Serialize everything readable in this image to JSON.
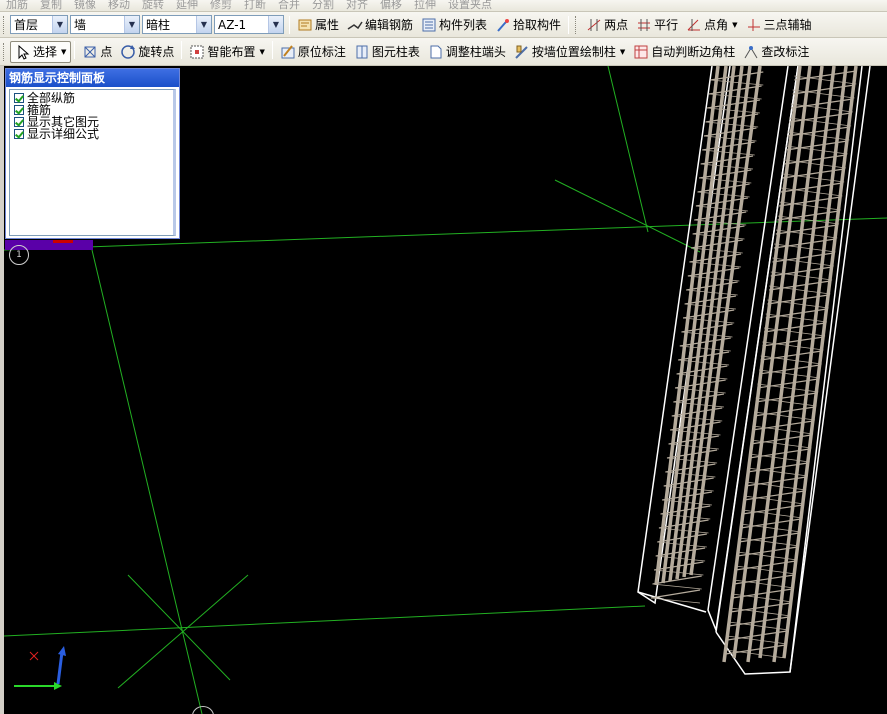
{
  "ghost_toolbar": [
    "加筋",
    "复制",
    "镜像",
    "移动",
    "旋转",
    "延伸",
    "修剪",
    "打断",
    "合并",
    "分割",
    "对齐",
    "偏移",
    "拉伸",
    "设置夹点"
  ],
  "toolbar1": {
    "floor": "首层",
    "component_type": "墙",
    "sub_type": "暗柱",
    "component_name": "AZ-1",
    "buttons": [
      {
        "name": "properties",
        "label": "属性",
        "icon": "properties-icon"
      },
      {
        "name": "edit-rebar",
        "label": "编辑钢筋",
        "icon": "edit-rebar-icon"
      },
      {
        "name": "component-list",
        "label": "构件列表",
        "icon": "list-icon"
      },
      {
        "name": "pick-component",
        "label": "拾取构件",
        "icon": "pick-icon"
      }
    ],
    "snap_buttons": [
      {
        "name": "two-points",
        "label": "两点",
        "icon": "two-points-icon"
      },
      {
        "name": "parallel",
        "label": "平行",
        "icon": "parallel-icon"
      },
      {
        "name": "point-angle",
        "label": "点角",
        "icon": "point-angle-icon"
      },
      {
        "name": "three-point-axis",
        "label": "三点辅轴",
        "icon": "three-point-icon"
      }
    ]
  },
  "toolbar2": {
    "buttons": [
      {
        "name": "select",
        "label": "选择",
        "icon": "cursor-icon"
      },
      {
        "name": "point",
        "label": "点",
        "icon": "point-icon"
      },
      {
        "name": "rotate-point",
        "label": "旋转点",
        "icon": "rotate-icon"
      },
      {
        "name": "smart-layout",
        "label": "智能布置",
        "icon": "smart-layout-icon"
      },
      {
        "name": "in-place-annotation",
        "label": "原位标注",
        "icon": "annotation-icon"
      },
      {
        "name": "element-column-table",
        "label": "图元柱表",
        "icon": "column-table-icon"
      },
      {
        "name": "adjust-column-end",
        "label": "调整柱端头",
        "icon": "column-end-icon"
      },
      {
        "name": "draw-column-by-wall",
        "label": "按墙位置绘制柱",
        "icon": "wall-column-icon"
      },
      {
        "name": "auto-corner-column",
        "label": "自动判断边角柱",
        "icon": "corner-column-icon"
      },
      {
        "name": "check-annotation",
        "label": "查改标注",
        "icon": "check-annotation-icon"
      }
    ]
  },
  "panel": {
    "title": "钢筋显示控制面板",
    "items": [
      {
        "label": "全部纵筋",
        "checked": true
      },
      {
        "label": "箍筋",
        "checked": true
      },
      {
        "label": "显示其它图元",
        "checked": true
      },
      {
        "label": "显示详细公式",
        "checked": true
      }
    ]
  },
  "viewport": {
    "axis_marker": "1",
    "triad": {
      "x": "X",
      "y": "Y",
      "z": "Z"
    },
    "colors": {
      "background": "#000000",
      "grid": "#22b022",
      "rebar": "#b5ab9c",
      "outline": "#ffffff"
    }
  }
}
